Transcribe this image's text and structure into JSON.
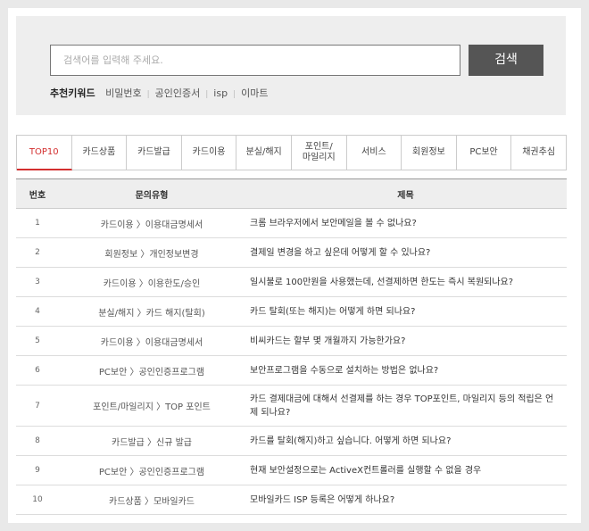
{
  "search": {
    "placeholder": "검색어를 입력해 주세요.",
    "button_label": "검색",
    "keywords_title": "추천키워드",
    "keywords": [
      "비밀번호",
      "공인인증서",
      "isp",
      "이마트"
    ]
  },
  "tabs": [
    {
      "label": "TOP10",
      "active": true
    },
    {
      "label": "카드상품"
    },
    {
      "label": "카드발급"
    },
    {
      "label": "카드이용"
    },
    {
      "label": "분실/해지"
    },
    {
      "label": "포인트/\n마일리지"
    },
    {
      "label": "서비스"
    },
    {
      "label": "회원정보"
    },
    {
      "label": "PC보안"
    },
    {
      "label": "채권추심"
    }
  ],
  "table": {
    "headers": {
      "num": "번호",
      "type": "문의유형",
      "title": "제목"
    },
    "rows": [
      {
        "num": "1",
        "type": "카드이용 〉이용대금명세서",
        "title": "크롬 브라우저에서 보안메일을 볼 수 없나요?"
      },
      {
        "num": "2",
        "type": "회원정보 〉개인정보변경",
        "title": "결제일 변경을 하고 싶은데 어떻게 할 수 있나요?"
      },
      {
        "num": "3",
        "type": "카드이용 〉이용한도/승인",
        "title": "일시불로 100만원을 사용했는데, 선결제하면 한도는 즉시 복원되나요?"
      },
      {
        "num": "4",
        "type": "분실/해지 〉카드 해지(탈회)",
        "title": "카드 탈회(또는 해지)는 어떻게 하면 되나요?"
      },
      {
        "num": "5",
        "type": "카드이용 〉이용대금명세서",
        "title": "비씨카드는 할부 몇 개월까지 가능한가요?"
      },
      {
        "num": "6",
        "type": "PC보안 〉공인인증프로그램",
        "title": "보안프로그램을 수동으로 설치하는 방법은 없나요?"
      },
      {
        "num": "7",
        "type": "포인트/마일리지 〉TOP 포인트",
        "title": "카드 결제대금에 대해서 선결제를 하는 경우 TOP포인트, 마일리지 등의 적립은 언제 되나요?"
      },
      {
        "num": "8",
        "type": "카드발급 〉신규 발급",
        "title": "카드를 탈회(해지)하고 싶습니다. 어떻게 하면 되나요?"
      },
      {
        "num": "9",
        "type": "PC보안 〉공인인증프로그램",
        "title": "현재 보안설정으로는 ActiveX컨트롤러를 실행할 수 없을 경우"
      },
      {
        "num": "10",
        "type": "카드상품 〉모바일카드",
        "title": "모바일카드 ISP 등록은 어떻게 하나요?"
      }
    ]
  },
  "colors": {
    "accent": "#d32f2f",
    "button": "#555555",
    "panel": "#eeeeee"
  }
}
